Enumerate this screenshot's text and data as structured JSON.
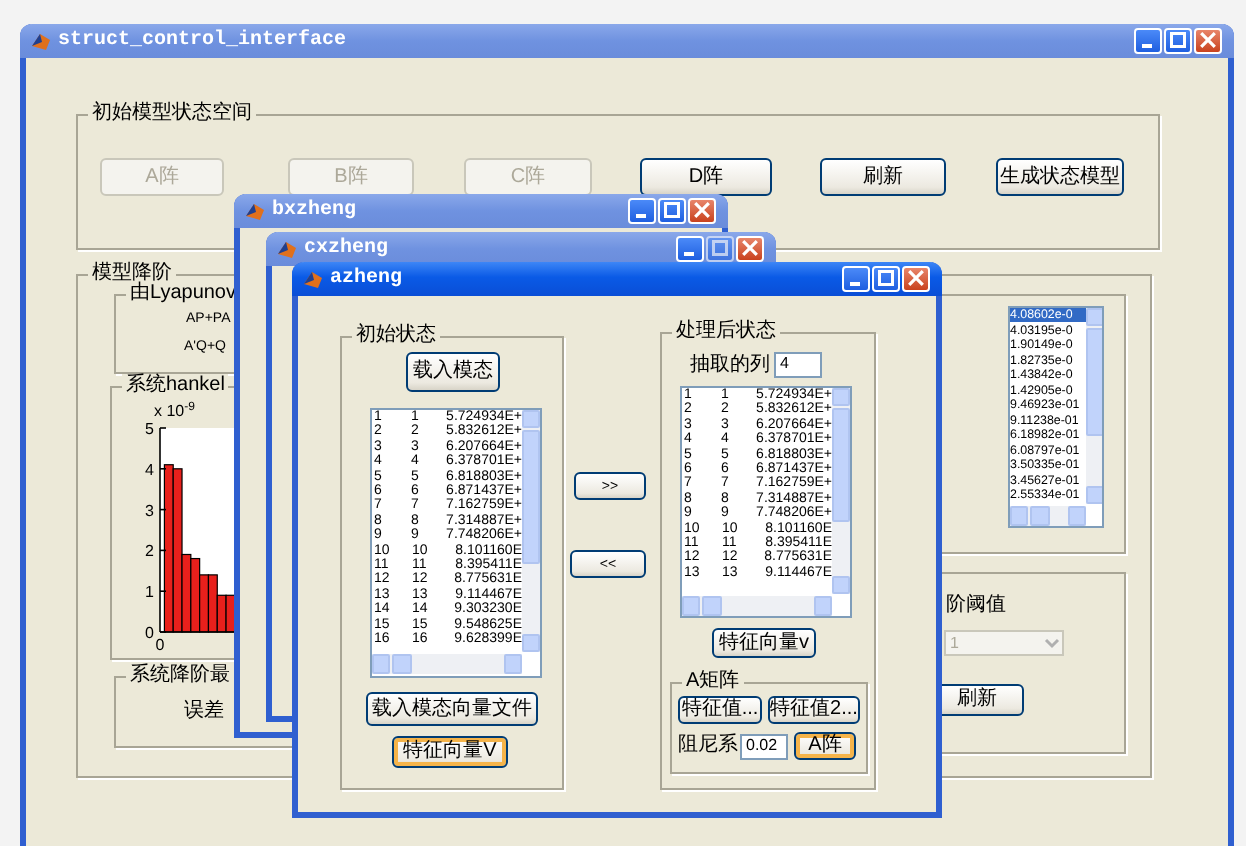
{
  "main_window": {
    "title": "struct_control_interface",
    "active": false,
    "initial_panel": {
      "title": "初始模型状态空间",
      "buttons": [
        {
          "label": "A阵",
          "disabled": true
        },
        {
          "label": "B阵",
          "disabled": true
        },
        {
          "label": "C阵",
          "disabled": true
        },
        {
          "label": "D阵",
          "disabled": false
        },
        {
          "label": "刷新",
          "disabled": false
        },
        {
          "label": "生成状态模型",
          "disabled": false
        }
      ]
    },
    "reduction_panel": {
      "title": "模型降阶",
      "lyapunov_panel": {
        "title": "由Lyapunov",
        "equations": [
          "AP+PA",
          "A'Q+Q"
        ]
      },
      "hankel_panel": {
        "title": "系统hankel",
        "chart_data": {
          "type": "bar",
          "series": [
            {
              "color": "#e8201c",
              "values": [
                4.1,
                4.0,
                1.9,
                1.8,
                1.4,
                1.4,
                0.9,
                0.9
              ]
            }
          ],
          "ylim": [
            0,
            5
          ],
          "yticks": [
            0,
            1,
            2,
            3,
            4,
            5
          ],
          "annotations": [
            {
              "text": "x 10$^{-9}$"
            },
            {
              "text": "0"
            }
          ]
        }
      },
      "error_panel": {
        "title": "系统降阶最",
        "text": "误差"
      },
      "singular_values": [
        {
          "text": "4.08602e-0",
          "selected": true
        },
        {
          "text": "4.03195e-0",
          "selected": false
        },
        {
          "text": "1.90149e-0",
          "selected": false
        },
        {
          "text": "1.82735e-0",
          "selected": false
        },
        {
          "text": "1.43842e-0",
          "selected": false
        },
        {
          "text": "1.42905e-0",
          "selected": false
        },
        {
          "text": "9.46923e-01",
          "selected": false
        },
        {
          "text": "9.11238e-01",
          "selected": false
        },
        {
          "text": "6.18982e-01",
          "selected": false
        },
        {
          "text": "6.08797e-01",
          "selected": false
        },
        {
          "text": "3.50335e-01",
          "selected": false
        },
        {
          "text": "3.45627e-01",
          "selected": false
        },
        {
          "text": "2.55334e-01",
          "selected": false
        }
      ],
      "order_panel": {
        "label": "阶阈值",
        "dropdown": {
          "value": "1",
          "disabled": true
        },
        "button": "刷新"
      }
    }
  },
  "windows": [
    {
      "title": "bxzheng",
      "active": false,
      "maximize_disabled": false
    },
    {
      "title": "cxzheng",
      "active": false,
      "maximize_disabled": true
    }
  ],
  "azheng": {
    "title": "azheng",
    "active": true,
    "initial_state": {
      "title": "初始状态",
      "load_button": "载入模态",
      "rows": [
        [
          "1",
          "1",
          "5.724934E+"
        ],
        [
          "2",
          "2",
          "5.832612E+"
        ],
        [
          "3",
          "3",
          "6.207664E+"
        ],
        [
          "4",
          "4",
          "6.378701E+"
        ],
        [
          "5",
          "5",
          "6.818803E+"
        ],
        [
          "6",
          "6",
          "6.871437E+"
        ],
        [
          "7",
          "7",
          "7.162759E+"
        ],
        [
          "8",
          "8",
          "7.314887E+"
        ],
        [
          "9",
          "9",
          "7.748206E+"
        ],
        [
          "10",
          "10",
          "8.101160E"
        ],
        [
          "11",
          "11",
          "8.395411E"
        ],
        [
          "12",
          "12",
          "8.775631E"
        ],
        [
          "13",
          "13",
          "9.114467E"
        ],
        [
          "14",
          "14",
          "9.303230E"
        ],
        [
          "15",
          "15",
          "9.548625E"
        ],
        [
          "16",
          "16",
          "9.628399E"
        ]
      ],
      "buttons": [
        {
          "label": "载入模态向量文件",
          "focused": false
        },
        {
          "label": "特征向量V",
          "focused": true
        }
      ]
    },
    "transfer_buttons": [
      ">>",
      "<<"
    ],
    "processed_state": {
      "title": "处理后状态",
      "column_label": "抽取的列",
      "column_value": "4",
      "rows": [
        [
          "1",
          "1",
          "5.724934E+"
        ],
        [
          "2",
          "2",
          "5.832612E+"
        ],
        [
          "3",
          "3",
          "6.207664E+"
        ],
        [
          "4",
          "4",
          "6.378701E+"
        ],
        [
          "5",
          "5",
          "6.818803E+"
        ],
        [
          "6",
          "6",
          "6.871437E+"
        ],
        [
          "7",
          "7",
          "7.162759E+"
        ],
        [
          "8",
          "8",
          "7.314887E+"
        ],
        [
          "9",
          "9",
          "7.748206E+"
        ],
        [
          "10",
          "10",
          "8.101160E"
        ],
        [
          "11",
          "11",
          "8.395411E"
        ],
        [
          "12",
          "12",
          "8.775631E"
        ],
        [
          "13",
          "13",
          "9.114467E"
        ]
      ],
      "button": "特征向量v",
      "a_matrix": {
        "title": "A矩阵",
        "buttons": [
          {
            "label": "特征值...",
            "focused": false
          },
          {
            "label": "特征值2...",
            "focused": false
          }
        ],
        "damping_label": "阻尼系",
        "damping_value": "0.02",
        "apply_button": {
          "label": "A阵",
          "focused": true
        }
      }
    }
  }
}
